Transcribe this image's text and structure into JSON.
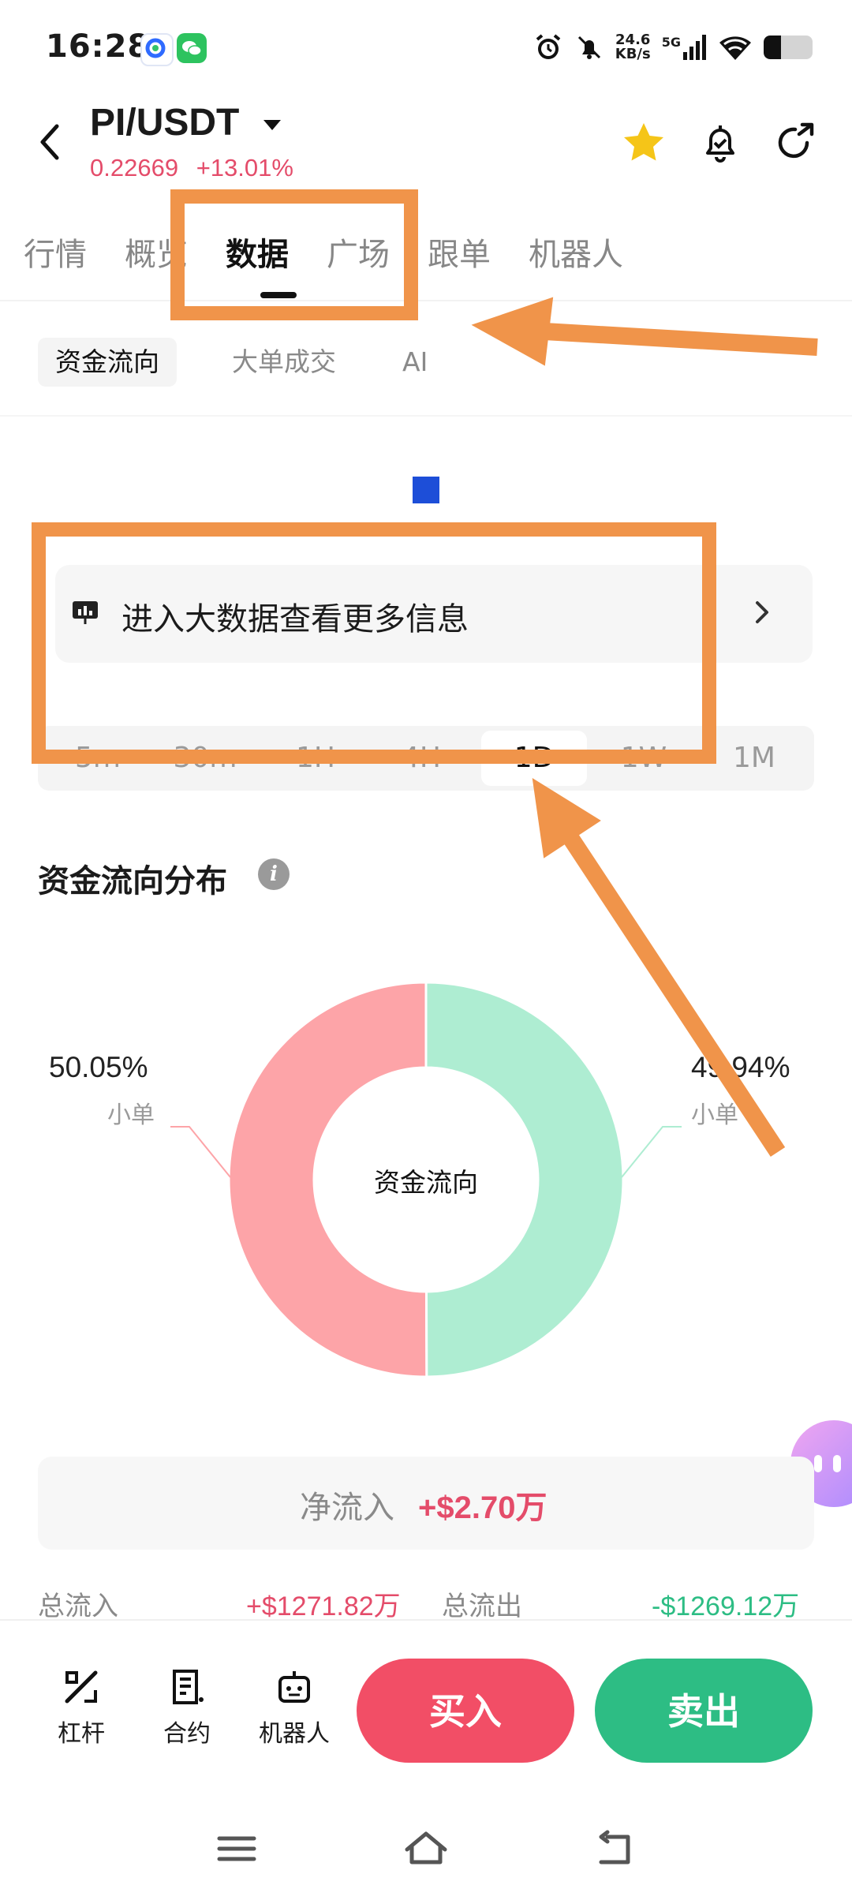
{
  "status_bar": {
    "time": "16:28",
    "net_speed_value": "24.6",
    "net_speed_unit": "KB/s",
    "signal_label": "5G",
    "battery_level": 0.35,
    "icons": [
      "alarm-icon",
      "mute-icon",
      "signal-icon",
      "wifi-icon",
      "battery-icon"
    ]
  },
  "header": {
    "pair": "PI/USDT",
    "price": "0.22669",
    "change": "+13.01%",
    "colors": {
      "up": "#e44c6a",
      "down": "#2dbd84",
      "star": "#f5c518"
    }
  },
  "main_tabs": [
    {
      "label": "行情",
      "active": false
    },
    {
      "label": "概览",
      "active": false
    },
    {
      "label": "数据",
      "active": true
    },
    {
      "label": "广场",
      "active": false
    },
    {
      "label": "跟单",
      "active": false
    },
    {
      "label": "机器人",
      "active": false
    }
  ],
  "sub_tabs": [
    {
      "label": "资金流向",
      "active": true
    },
    {
      "label": "大单成交",
      "active": false
    },
    {
      "label": "AI",
      "active": false
    }
  ],
  "big_data_link": {
    "label": "进入大数据查看更多信息"
  },
  "timeframes": [
    {
      "label": "5m",
      "active": false
    },
    {
      "label": "30m",
      "active": false
    },
    {
      "label": "1H",
      "active": false
    },
    {
      "label": "4H",
      "active": false
    },
    {
      "label": "1D",
      "active": true
    },
    {
      "label": "1W",
      "active": false
    },
    {
      "label": "1M",
      "active": false
    }
  ],
  "distribution": {
    "title": "资金流向分布",
    "center_label": "资金流向",
    "left_pct": "50.05%",
    "left_label": "小单",
    "right_pct": "49.94%",
    "right_label": "小单",
    "colors": {
      "outflow": "#fda4a8",
      "inflow": "#aeedd2"
    }
  },
  "chart_data": {
    "type": "pie",
    "title": "资金流向分布",
    "slices": [
      {
        "label": "小单",
        "value": 50.05
      },
      {
        "label": "小单",
        "value": 49.94
      }
    ]
  },
  "net_flow": {
    "label": "净流入",
    "value": "+$2.70万"
  },
  "totals": {
    "in_label": "总流入",
    "in_value": "+$1271.82万",
    "out_label": "总流出",
    "out_value": "-$1269.12万"
  },
  "bottom_bar": {
    "items": [
      {
        "label": "杠杆",
        "icon": "leverage-icon"
      },
      {
        "label": "合约",
        "icon": "contract-icon"
      },
      {
        "label": "机器人",
        "icon": "robot-icon"
      }
    ],
    "buy_label": "买入",
    "sell_label": "卖出"
  },
  "annotation_color": "#f0944a"
}
